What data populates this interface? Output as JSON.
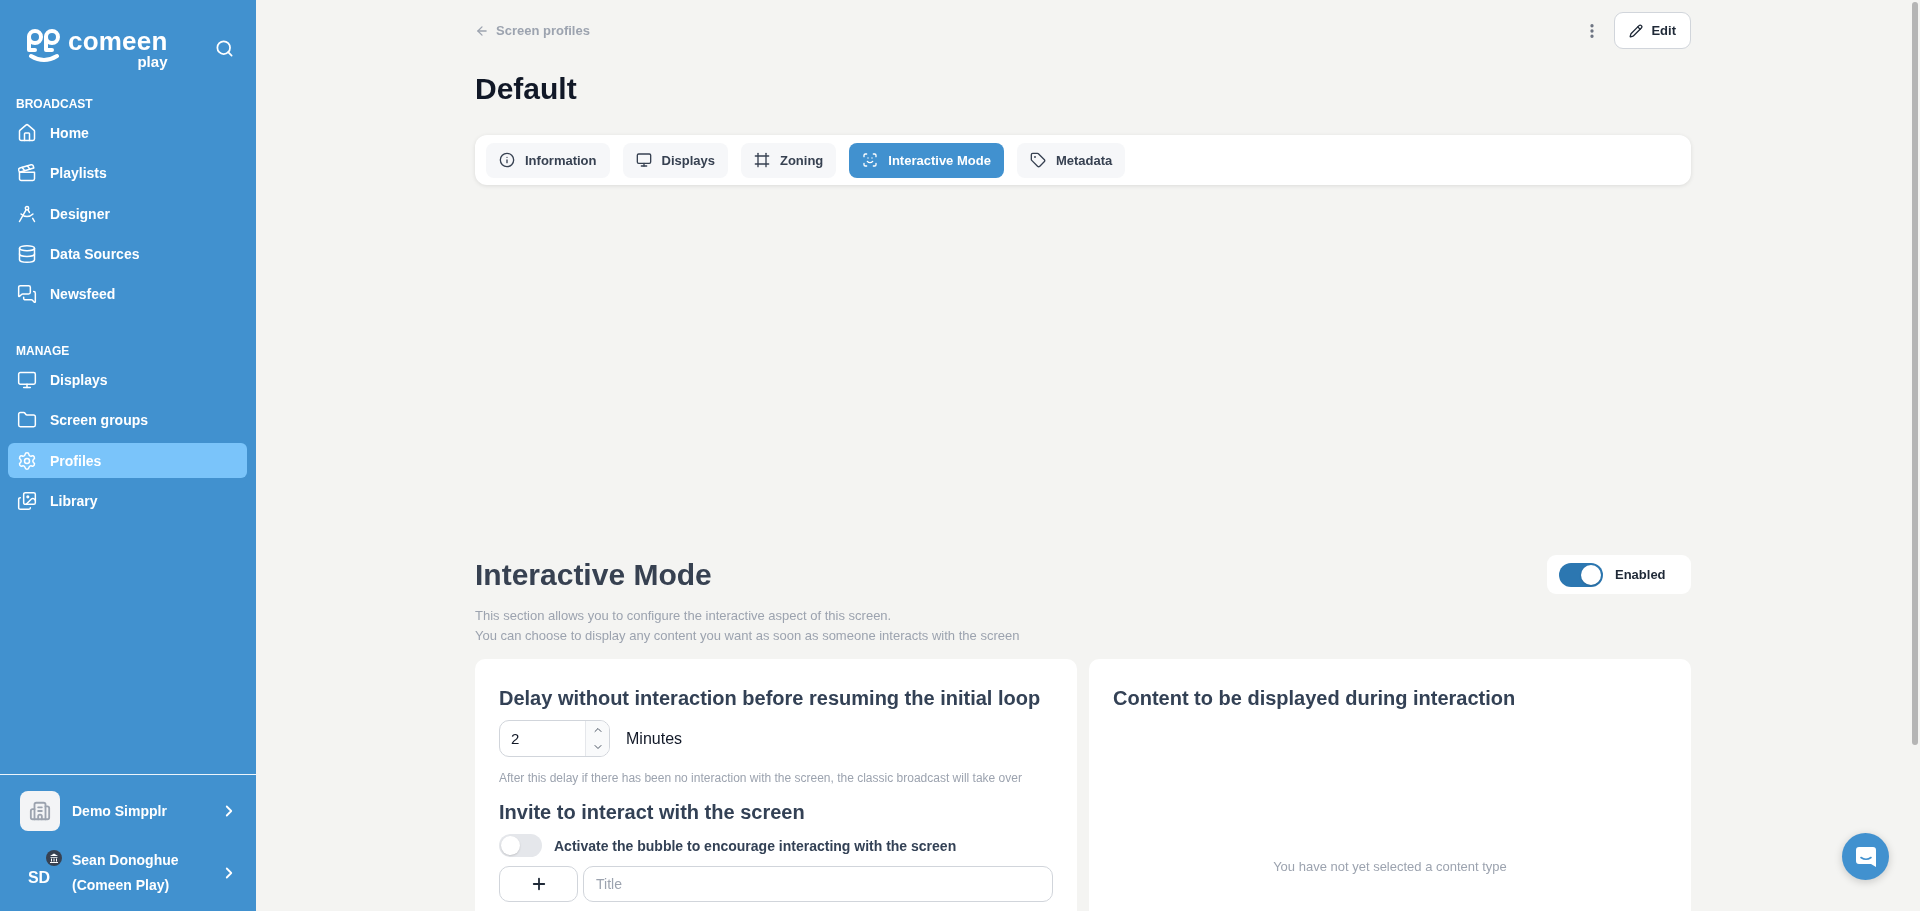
{
  "sidebar": {
    "logo": {
      "name": "comeen",
      "sub": "play"
    },
    "sections": [
      {
        "title": "BROADCAST",
        "items": [
          {
            "label": "Home",
            "selected": false
          },
          {
            "label": "Playlists",
            "selected": false
          },
          {
            "label": "Designer",
            "selected": false
          },
          {
            "label": "Data Sources",
            "selected": false
          },
          {
            "label": "Newsfeed",
            "selected": false
          }
        ]
      },
      {
        "title": "MANAGE",
        "items": [
          {
            "label": "Displays",
            "selected": false
          },
          {
            "label": "Screen groups",
            "selected": false
          },
          {
            "label": "Profiles",
            "selected": true
          },
          {
            "label": "Library",
            "selected": false
          }
        ]
      }
    ],
    "organization": {
      "name": "Demo Simpplr"
    },
    "user": {
      "initials": "SD",
      "name": "Sean Donoghue",
      "company": "(Comeen Play)"
    }
  },
  "header": {
    "back_link": "Screen profiles",
    "edit_button": "Edit",
    "title": "Default"
  },
  "tabs": [
    {
      "label": "Information",
      "selected": false
    },
    {
      "label": "Displays",
      "selected": false
    },
    {
      "label": "Zoning",
      "selected": false
    },
    {
      "label": "Interactive Mode",
      "selected": true
    },
    {
      "label": "Metadata",
      "selected": false
    }
  ],
  "interactive_mode": {
    "title": "Interactive Mode",
    "toggle": {
      "label": "Enabled",
      "on": true
    },
    "description": [
      "This section allows you to configure the interactive aspect of this screen.",
      "You can choose to display any content you want as soon as someone interacts with the screen"
    ]
  },
  "delay_card": {
    "title": "Delay without interaction before resuming the initial loop",
    "delay": {
      "value": "2",
      "unit": "Minutes"
    },
    "hint": "After this delay if there has been no interaction with the screen, the classic broadcast will take over",
    "invite_title": "Invite to interact with the screen",
    "bubble_toggle": {
      "label": "Activate the bubble to encourage interacting with the screen",
      "on": false
    },
    "title_field": {
      "placeholder": "Title"
    }
  },
  "content_card": {
    "title": "Content to be displayed during interaction",
    "empty_message": "You have not yet selected a content type"
  }
}
